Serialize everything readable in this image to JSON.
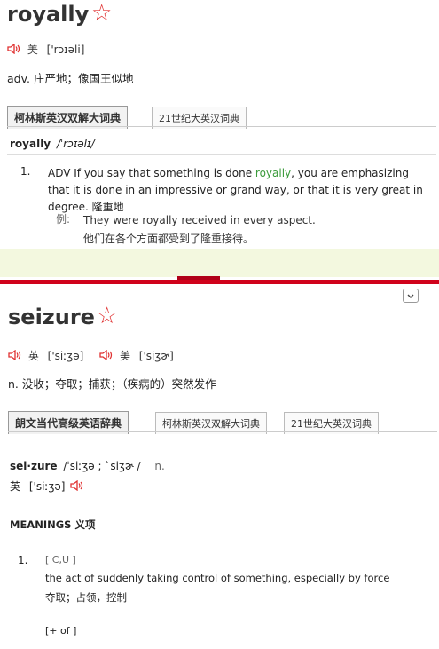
{
  "entry1": {
    "word": "royally",
    "star": "☆",
    "pron_region": "美",
    "pron": "['rɔɪəli]",
    "definition": "adv. 庄严地；像国王似地",
    "tabs": [
      "柯林斯英汉双解大词典",
      "21世纪大英汉词典"
    ],
    "head_word": "royally",
    "head_pron": "/ˈrɔɪəlɪ/",
    "sense_num": "1.",
    "sense_pre": "ADV If you say that something is done ",
    "sense_hl": "royally",
    "sense_post": ", you are emphasizing that it is done in an impressive or grand way, or that it is very great in degree. 隆重地",
    "example_label": "例:",
    "example_en": "They were royally received in every aspect.",
    "example_zh": "他们在各个方面都受到了隆重接待。"
  },
  "entry2": {
    "word": "seizure",
    "star": "☆",
    "pron_uk_region": "英",
    "pron_uk": "['siːʒə]",
    "pron_us_region": "美",
    "pron_us": "['siʒɚ]",
    "definition": "n. 没收；夺取；捕获；（疾病的）突然发作",
    "tabs": [
      "朗文当代高级英语辞典",
      "柯林斯英汉双解大词典",
      "21世纪大英汉词典"
    ],
    "head_word": "sei·zure",
    "head_pron": "/ˈsiːʒə ; ˋsiʒɚ /",
    "head_pos": "n.",
    "head_uk_region": "英",
    "head_uk_pron": "['siːʒə]",
    "meanings_heading": "MEANINGS 义项",
    "sense_num": "1.",
    "grammar": "[ C,U ]",
    "sense_en": "the act of suddenly taking control of something, especially by force",
    "sense_zh": "夺取；占领，控制",
    "collocation": "[+ of ]"
  },
  "colors": {
    "accent_red": "#d0021b",
    "highlight_green": "#3a9a3a",
    "band": "#f3f8df"
  },
  "icons": [
    "speaker-icon",
    "star-icon",
    "chevron-down-icon"
  ]
}
